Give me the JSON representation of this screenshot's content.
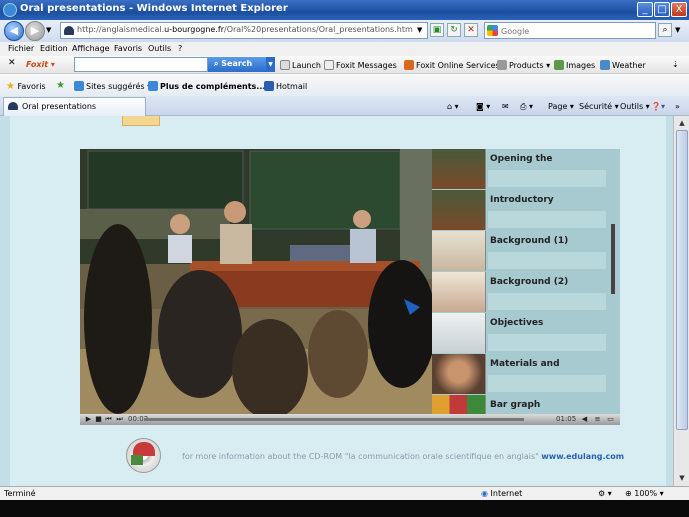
{
  "window": {
    "title": "Oral presentations - Windows Internet Explorer",
    "minimize_glyph": "_",
    "maximize_glyph": "□",
    "close_glyph": "X"
  },
  "address_bar": {
    "url_prefix": "http://anglaismedical.",
    "url_domain": "u-bourgogne.fr",
    "url_path": "/Oral%20presentations/Oral_presentations.htm",
    "search_placeholder": "Google"
  },
  "menu": [
    "Fichier",
    "Edition",
    "Affichage",
    "Favoris",
    "Outils",
    "?"
  ],
  "foxit_toolbar": {
    "brand": "Foxit",
    "search_label": "Search",
    "items": [
      "Launch",
      "Foxit Messages",
      "Foxit Online Services",
      "Products",
      "Images",
      "Weather"
    ]
  },
  "favorites_bar": {
    "favorites_label": "Favoris",
    "items": [
      "Sites suggérés",
      "Plus de compléments...",
      "Hotmail"
    ]
  },
  "tab_bar": {
    "tab_label": "Oral presentations",
    "tools": [
      "Page",
      "Sécurité",
      "Outils"
    ]
  },
  "player": {
    "chapters": [
      {
        "title": "Opening the"
      },
      {
        "title": "Introductory"
      },
      {
        "title": "Background (1)"
      },
      {
        "title": "Background (2)"
      },
      {
        "title": "Objectives"
      },
      {
        "title": "Materials and"
      },
      {
        "title": "Bar graph"
      }
    ],
    "elapsed": "00:02",
    "duration": "01:05",
    "progress": 0.0
  },
  "footer": {
    "text": "for more information about the CD-ROM \"la communication orale scientifique en anglais\"",
    "link": "www.edulang.com"
  },
  "status_bar": {
    "status": "Terminé",
    "zone": "Internet",
    "zoom": "100%"
  },
  "colors": {
    "title_bar": "#1b4f9e",
    "page_bg": "#d8edf2",
    "chapter_bg": "#a7c9d0",
    "link": "#2a5fb0"
  }
}
